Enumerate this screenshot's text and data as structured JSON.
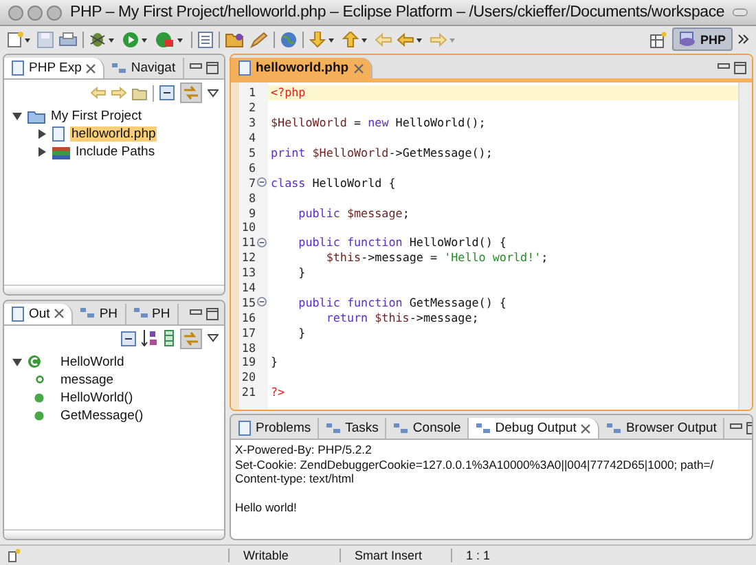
{
  "window": {
    "title": "PHP – My First Project/helloworld.php – Eclipse Platform – /Users/ckieffer/Documents/workspace"
  },
  "perspective": {
    "label": "PHP",
    "selected": true
  },
  "explorer": {
    "tabs": [
      {
        "label": "PHP Exp",
        "selected": true
      },
      {
        "label": "Navigat",
        "selected": false
      }
    ],
    "tree": [
      {
        "label": "My First Project",
        "kind": "project",
        "expanded": true,
        "selected": false,
        "children": [
          {
            "label": "helloworld.php",
            "kind": "file",
            "expanded": false,
            "selected": true
          },
          {
            "label": "Include Paths",
            "kind": "library",
            "expanded": false,
            "selected": false
          }
        ]
      }
    ]
  },
  "outline": {
    "tabs": [
      {
        "label": "Out",
        "selected": true
      },
      {
        "label": "PH",
        "selected": false
      },
      {
        "label": "PH",
        "selected": false
      }
    ],
    "tree": [
      {
        "label": "HelloWorld",
        "kind": "class",
        "expanded": true,
        "children": [
          {
            "label": "message",
            "kind": "field"
          },
          {
            "label": "HelloWorld()",
            "kind": "method"
          },
          {
            "label": "GetMessage()",
            "kind": "method"
          }
        ]
      }
    ]
  },
  "editor": {
    "tabs": [
      {
        "label": "helloworld.php",
        "selected": true
      }
    ],
    "lines": [
      {
        "number": "1",
        "current": true,
        "fold": false,
        "tokens": [
          {
            "text": "<?php",
            "kind": "tag"
          }
        ]
      },
      {
        "number": "2",
        "current": false,
        "fold": false
      },
      {
        "number": "3",
        "current": false,
        "fold": false,
        "tokens": [
          {
            "text": "$HelloWorld",
            "kind": "var"
          },
          {
            "text": " = ",
            "kind": "plain"
          },
          {
            "text": "new",
            "kind": "keyword"
          },
          {
            "text": " HelloWorld();",
            "kind": "plain"
          }
        ]
      },
      {
        "number": "4",
        "current": false,
        "fold": false
      },
      {
        "number": "5",
        "current": false,
        "fold": false,
        "tokens": [
          {
            "text": "print",
            "kind": "keyword"
          },
          {
            "text": " $HelloWorld",
            "kind": "var"
          },
          {
            "text": "->GetMessage();",
            "kind": "plain"
          }
        ]
      },
      {
        "number": "6",
        "current": false,
        "fold": false
      },
      {
        "number": "7",
        "current": false,
        "fold": true,
        "tokens": [
          {
            "text": "class",
            "kind": "keyword"
          },
          {
            "text": " HelloWorld {",
            "kind": "plain"
          }
        ]
      },
      {
        "number": "8",
        "current": false,
        "fold": false
      },
      {
        "number": "9",
        "current": false,
        "fold": false,
        "tokens": [
          {
            "text": "    public",
            "kind": "keyword"
          },
          {
            "text": " $message",
            "kind": "var"
          },
          {
            "text": ";",
            "kind": "plain"
          }
        ]
      },
      {
        "number": "10",
        "current": false,
        "fold": false
      },
      {
        "number": "11",
        "current": false,
        "fold": true,
        "tokens": [
          {
            "text": "    public function",
            "kind": "keyword"
          },
          {
            "text": " HelloWorld() {",
            "kind": "plain"
          }
        ]
      },
      {
        "number": "12",
        "current": false,
        "fold": false,
        "tokens": [
          {
            "text": "        $this",
            "kind": "var"
          },
          {
            "text": "->message = ",
            "kind": "plain"
          },
          {
            "text": "'Hello world!'",
            "kind": "string"
          },
          {
            "text": ";",
            "kind": "plain"
          }
        ]
      },
      {
        "number": "13",
        "current": false,
        "fold": false,
        "tokens": [
          {
            "text": "    }",
            "kind": "plain"
          }
        ]
      },
      {
        "number": "14",
        "current": false,
        "fold": false
      },
      {
        "number": "15",
        "current": false,
        "fold": true,
        "tokens": [
          {
            "text": "    public function",
            "kind": "keyword"
          },
          {
            "text": " GetMessage() {",
            "kind": "plain"
          }
        ]
      },
      {
        "number": "16",
        "current": false,
        "fold": false,
        "tokens": [
          {
            "text": "        return",
            "kind": "keyword"
          },
          {
            "text": " $this",
            "kind": "var"
          },
          {
            "text": "->message;",
            "kind": "plain"
          }
        ]
      },
      {
        "number": "17",
        "current": false,
        "fold": false,
        "tokens": [
          {
            "text": "    }",
            "kind": "plain"
          }
        ]
      },
      {
        "number": "18",
        "current": false,
        "fold": false
      },
      {
        "number": "19",
        "current": false,
        "fold": false,
        "tokens": [
          {
            "text": "}",
            "kind": "plain"
          }
        ]
      },
      {
        "number": "20",
        "current": false,
        "fold": false
      },
      {
        "number": "21",
        "current": false,
        "fold": false,
        "tokens": [
          {
            "text": "?>",
            "kind": "tag"
          }
        ]
      }
    ]
  },
  "bottom": {
    "tabs": [
      {
        "label": "Problems",
        "selected": false
      },
      {
        "label": "Tasks",
        "selected": false
      },
      {
        "label": "Console",
        "selected": false
      },
      {
        "label": "Debug Output",
        "selected": true
      },
      {
        "label": "Browser Output",
        "selected": false
      }
    ],
    "output": {
      "headers": [
        "X-Powered-By: PHP/5.2.2",
        "Set-Cookie: ZendDebuggerCookie=127.0.0.1%3A10000%3A0||004|77742D65|1000; path=/",
        "Content-type: text/html"
      ],
      "body": "Hello world!"
    }
  },
  "status_bar": {
    "mode": "Writable",
    "insert": "Smart Insert",
    "position": "1 : 1"
  }
}
